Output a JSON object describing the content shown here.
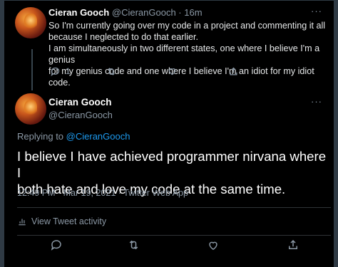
{
  "tweet1": {
    "author_name": "Cieran Gooch",
    "handle": "@CieranGooch",
    "dot": "·",
    "time": "16m",
    "text_lines": [
      "So I'm currently going over my code in a project and commenting it all",
      "because I neglected to do that earlier.",
      "I am simultaneously in two different states, one where I believe I'm a genius",
      "for my genius code and one where I believe I'm an idiot for my idiot code."
    ],
    "reply_count": "1",
    "icons": [
      "more-icon",
      "reply-icon",
      "retweet-icon",
      "like-icon",
      "share-icon"
    ]
  },
  "tweet2": {
    "author_name": "Cieran Gooch",
    "handle": "@CieranGooch",
    "replying_prefix": "Replying to",
    "replying_to": "@CieranGooch",
    "text_lines": [
      "I believe I have achieved programmer nirvana where I",
      "both hate and love my code at the same time."
    ],
    "meta": "12:49 PM · Mar 19, 2021 · Twitter Web App",
    "activity_label": "View Tweet activity",
    "icons": [
      "more-icon",
      "activity-icon",
      "reply-icon",
      "retweet-icon",
      "like-icon",
      "share-icon"
    ]
  },
  "colors": {
    "background": "#000000",
    "text_primary": "#ffffff",
    "text_secondary": "#8b98a5",
    "link": "#1d9bf0",
    "divider": "#2f3336"
  }
}
